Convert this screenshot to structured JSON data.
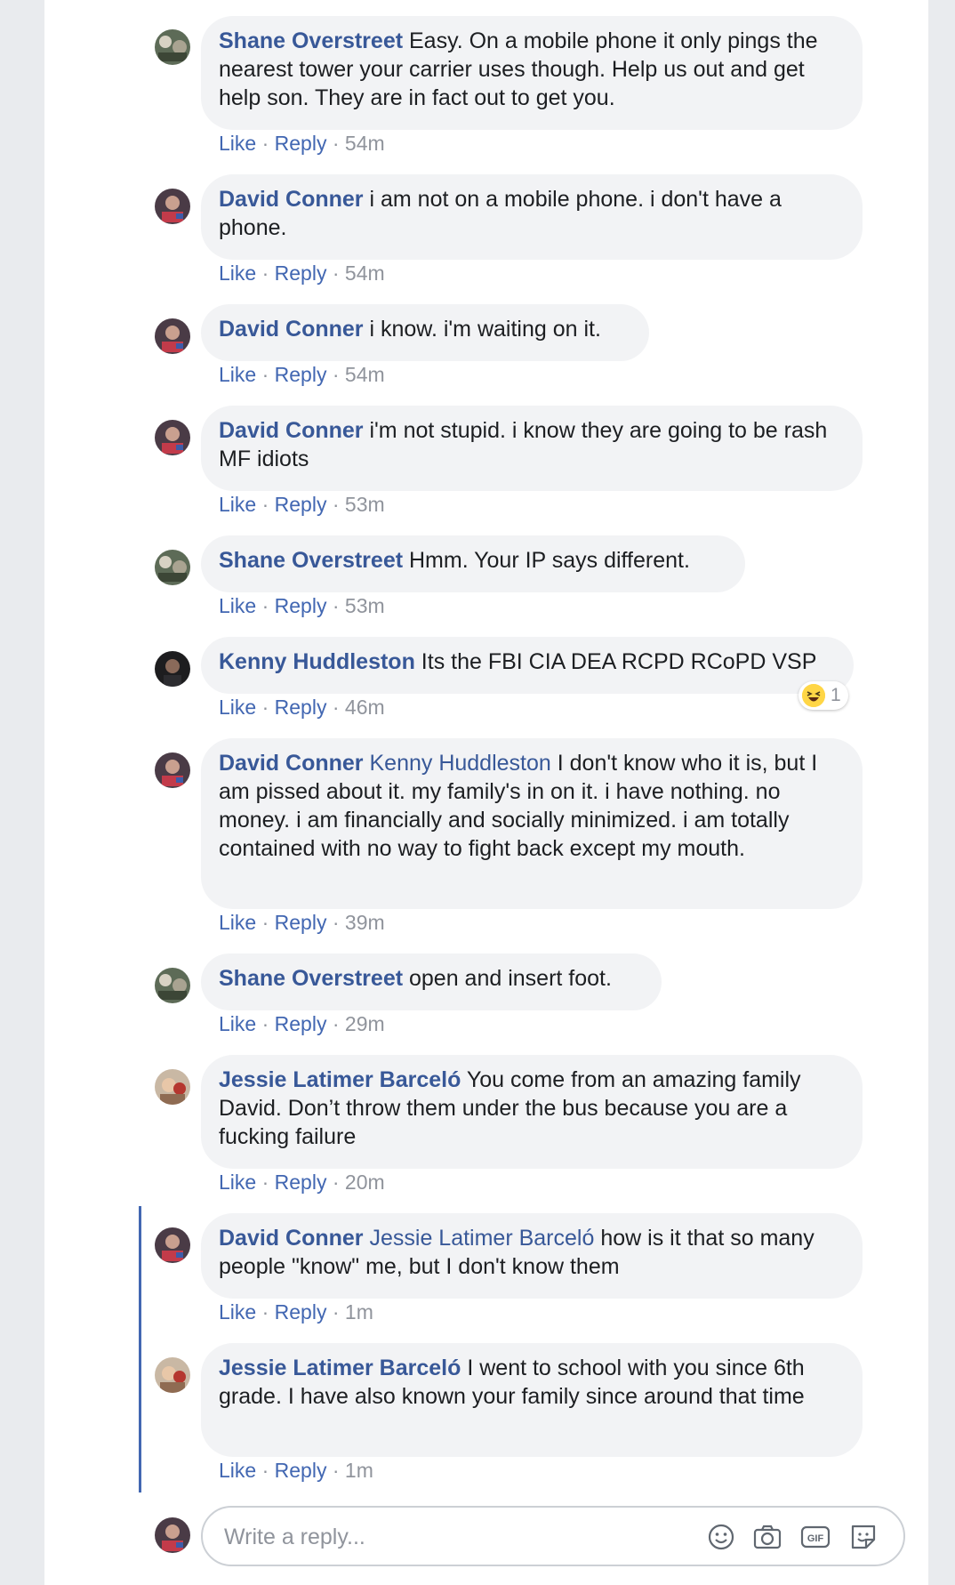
{
  "actions": {
    "like": "Like",
    "reply": "Reply",
    "separator": " · "
  },
  "comments": [
    {
      "author": "Shane Overstreet",
      "mention": "",
      "text": "Easy. On a mobile phone it only pings the nearest tower your carrier uses though. Help us out and get help son. They are in fact out to get you.",
      "lines": [
        "Easy. On a mobile phone it only pings",
        "the nearest tower your carrier uses though. Help us out",
        "and get help son. They are in fact out to get you."
      ],
      "time": "54m"
    },
    {
      "author": "David Conner",
      "mention": "",
      "text": "i am not on a mobile phone. i don't have a phone.",
      "time": "54m"
    },
    {
      "author": "David Conner",
      "mention": "",
      "text": "i know. i'm waiting on it.",
      "time": "54m"
    },
    {
      "author": "David Conner",
      "mention": "",
      "text": "i'm not stupid. i know they are going to be rash MF idiots",
      "time": "53m"
    },
    {
      "author": "Shane Overstreet",
      "mention": "",
      "text": "Hmm. Your IP says different.",
      "time": "53m"
    },
    {
      "author": "Kenny Huddleston",
      "mention": "",
      "text": "Its the FBI CIA DEA RCPD RCoPD VSP",
      "time": "46m",
      "reaction": {
        "emoji": "laughing-face",
        "count": "1"
      }
    },
    {
      "author": "David Conner",
      "mention": "Kenny Huddleston",
      "text": "I don't know who it is, but I am pissed about it. my family's in on it. i have nothing. no money. i am financially and socially minimized. i am totally contained with no way to fight back except my mouth.",
      "time": "39m"
    },
    {
      "author": "Shane Overstreet",
      "mention": "",
      "text": "open and insert foot.",
      "time": "29m"
    },
    {
      "author": "Jessie Latimer Barceló",
      "mention": "",
      "text": "You come from an amazing family David. Don’t throw them under the bus because you are a fucking failure",
      "time": "20m"
    },
    {
      "author": "David Conner",
      "mention": "Jessie Latimer Barceló",
      "text": "how is it that so many people \"know\" me, but I don't know them",
      "time": "1m"
    },
    {
      "author": "Jessie Latimer Barceló",
      "mention": "",
      "text": "I went to school with you since 6th grade. I have also known your family since around that time",
      "time": "1m"
    }
  ],
  "reply_box": {
    "placeholder": "Write a reply...",
    "icons": [
      "emoji-icon",
      "camera-icon",
      "gif-icon",
      "sticker-icon"
    ]
  },
  "colors": {
    "name": "#385898",
    "link": "#4267b2",
    "bubble": "#f2f3f5",
    "meta": "#90949c",
    "thread_line": "#4267b2"
  }
}
